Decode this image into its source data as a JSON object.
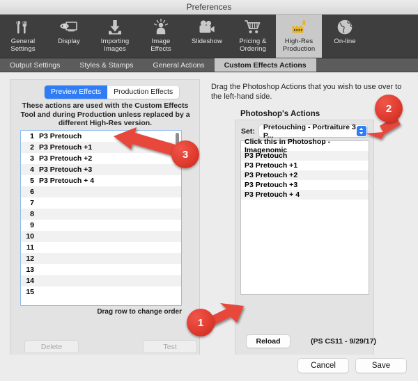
{
  "window": {
    "title": "Preferences"
  },
  "toolbar": {
    "items": [
      {
        "label": "General\nSettings",
        "icon": "tools-icon",
        "selected": false
      },
      {
        "label": "Display",
        "icon": "display-eye-icon",
        "selected": false
      },
      {
        "label": "Importing\nImages",
        "icon": "import-download-icon",
        "selected": false
      },
      {
        "label": "Image\nEffects",
        "icon": "image-effects-icon",
        "selected": false
      },
      {
        "label": "Slideshow",
        "icon": "movie-camera-icon",
        "selected": false
      },
      {
        "label": "Pricing &\nOrdering",
        "icon": "shopping-cart-icon",
        "selected": false
      },
      {
        "label": "High-Res\nProduction",
        "icon": "factory-icon",
        "selected": true
      },
      {
        "label": "On-line",
        "icon": "globe-icon",
        "selected": false
      }
    ]
  },
  "tabs": [
    {
      "label": "Output Settings",
      "active": false
    },
    {
      "label": "Styles & Stamps",
      "active": false
    },
    {
      "label": "General Actions",
      "active": false
    },
    {
      "label": "Custom Effects Actions",
      "active": true
    }
  ],
  "left_panel": {
    "segmented": [
      {
        "label": "Preview Effects",
        "selected": true
      },
      {
        "label": "Production Effects",
        "selected": false
      }
    ],
    "description": "These actions are used with the Custom Effects Tool and during Production unless replaced by a different High-Res version.",
    "rows": [
      {
        "num": "1",
        "name": "P3 Pretouch"
      },
      {
        "num": "2",
        "name": "P3 Pretouch +1"
      },
      {
        "num": "3",
        "name": "P3 Pretouch +2"
      },
      {
        "num": "4",
        "name": "P3 Pretouch +3"
      },
      {
        "num": "5",
        "name": "P3 Pretouch + 4"
      },
      {
        "num": "6",
        "name": ""
      },
      {
        "num": "7",
        "name": ""
      },
      {
        "num": "8",
        "name": ""
      },
      {
        "num": "9",
        "name": ""
      },
      {
        "num": "10",
        "name": ""
      },
      {
        "num": "11",
        "name": ""
      },
      {
        "num": "12",
        "name": ""
      },
      {
        "num": "13",
        "name": ""
      },
      {
        "num": "14",
        "name": ""
      },
      {
        "num": "15",
        "name": ""
      }
    ],
    "drag_note": "Drag row to change order",
    "delete_label": "Delete",
    "test_label": "Test"
  },
  "right_panel": {
    "intro": "Drag the Photoshop Actions that you wish to use over to the left-hand side.",
    "title": "Photoshop's Actions",
    "set_label": "Set:",
    "set_value": "Pretouching - Portraiture 3 P...",
    "actions": [
      "Click this in Photoshop - Imagenomic",
      "P3 Pretouch",
      "P3 Pretouch +1",
      "P3 Pretouch +2",
      "P3 Pretouch +3",
      "P3 Pretouch + 4"
    ],
    "reload_label": "Reload",
    "version_text": "(PS CS11 - 9/29/17)"
  },
  "footer": {
    "cancel_label": "Cancel",
    "save_label": "Save"
  },
  "annotations": {
    "accent_color": "#e03c30",
    "badges": [
      {
        "number": "1",
        "target": "reload-button"
      },
      {
        "number": "2",
        "target": "set-dropdown-stepper"
      },
      {
        "number": "3",
        "target": "effects-list"
      }
    ]
  }
}
